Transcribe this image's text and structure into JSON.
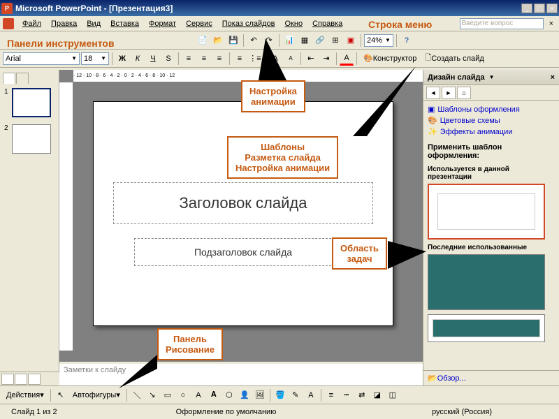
{
  "titlebar": {
    "app": "Microsoft PowerPoint",
    "doc": "[Презентация3]"
  },
  "menu": {
    "items": [
      "Файл",
      "Правка",
      "Вид",
      "Вставка",
      "Формат",
      "Сервис",
      "Показ слайдов",
      "Окно",
      "Справка"
    ],
    "help_placeholder": "Введите вопрос"
  },
  "annotations": {
    "menu_row": "Строка меню",
    "toolbars": "Панели инструментов",
    "animation_setup": "Настройка\nанимации",
    "templates_layout": "Шаблоны\nРазметка слайда\nНастройка анимации",
    "task_area": "Область\nзадач",
    "draw_panel": "Панель\nРисование"
  },
  "font": {
    "name": "Arial",
    "size": "18"
  },
  "format_buttons": {
    "bold": "Ж",
    "italic": "К",
    "underline": "Ч",
    "shadow": "S"
  },
  "toolbar_right": {
    "designer": "Конструктор",
    "new_slide": "Создать слайд"
  },
  "zoom": "24%",
  "slide": {
    "title_placeholder": "Заголовок слайда",
    "subtitle_placeholder": "Подзаголовок слайда",
    "notes": "Заметки к слайду"
  },
  "thumbs": [
    "1",
    "2"
  ],
  "taskpane": {
    "title": "Дизайн слайда",
    "links": [
      "Шаблоны оформления",
      "Цветовые схемы",
      "Эффекты анимации"
    ],
    "apply_label": "Применить шаблон оформления:",
    "group_current": "Используется в данной презентации",
    "group_recent": "Последние использованные",
    "browse": "Обзор..."
  },
  "drawbar": {
    "actions": "Действия",
    "autoshapes": "Автофигуры"
  },
  "status": {
    "slide": "Слайд 1 из 2",
    "design": "Оформление по умолчанию",
    "lang": "русский (Россия)"
  }
}
